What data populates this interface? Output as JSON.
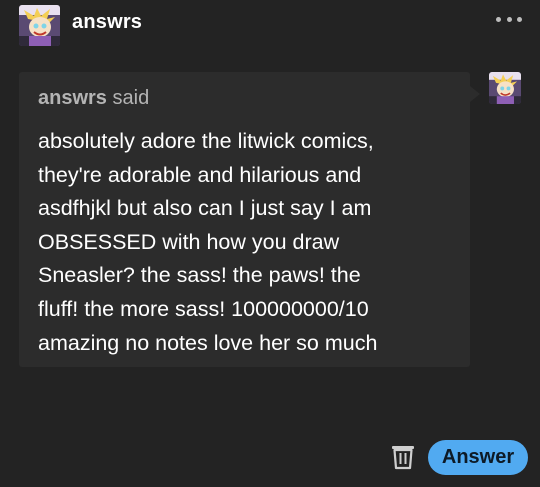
{
  "header": {
    "username": "answrs",
    "avatar_icon": "cartoon-character-avatar-icon",
    "more_icon": "more-options-icon"
  },
  "ask": {
    "asker_name": "answrs",
    "said_label": "said",
    "question_lines": [
      "absolutely adore the litwick comics,",
      "they're adorable and hilarious and",
      "asdfhjkl but also can I just say I am",
      "OBSESSED with how you draw",
      "Sneasler? the sass! the paws! the",
      "fluff! the more sass! 100000000/10",
      "amazing no notes love her so much"
    ],
    "asker_avatar_icon": "cartoon-character-avatar-icon"
  },
  "actions": {
    "delete_icon": "trash-icon",
    "answer_label": "Answer"
  },
  "colors": {
    "background": "#232323",
    "card": "#2c2c2c",
    "accent": "#51aaf1",
    "muted_text": "#b4b4b4",
    "text": "#ffffff"
  }
}
